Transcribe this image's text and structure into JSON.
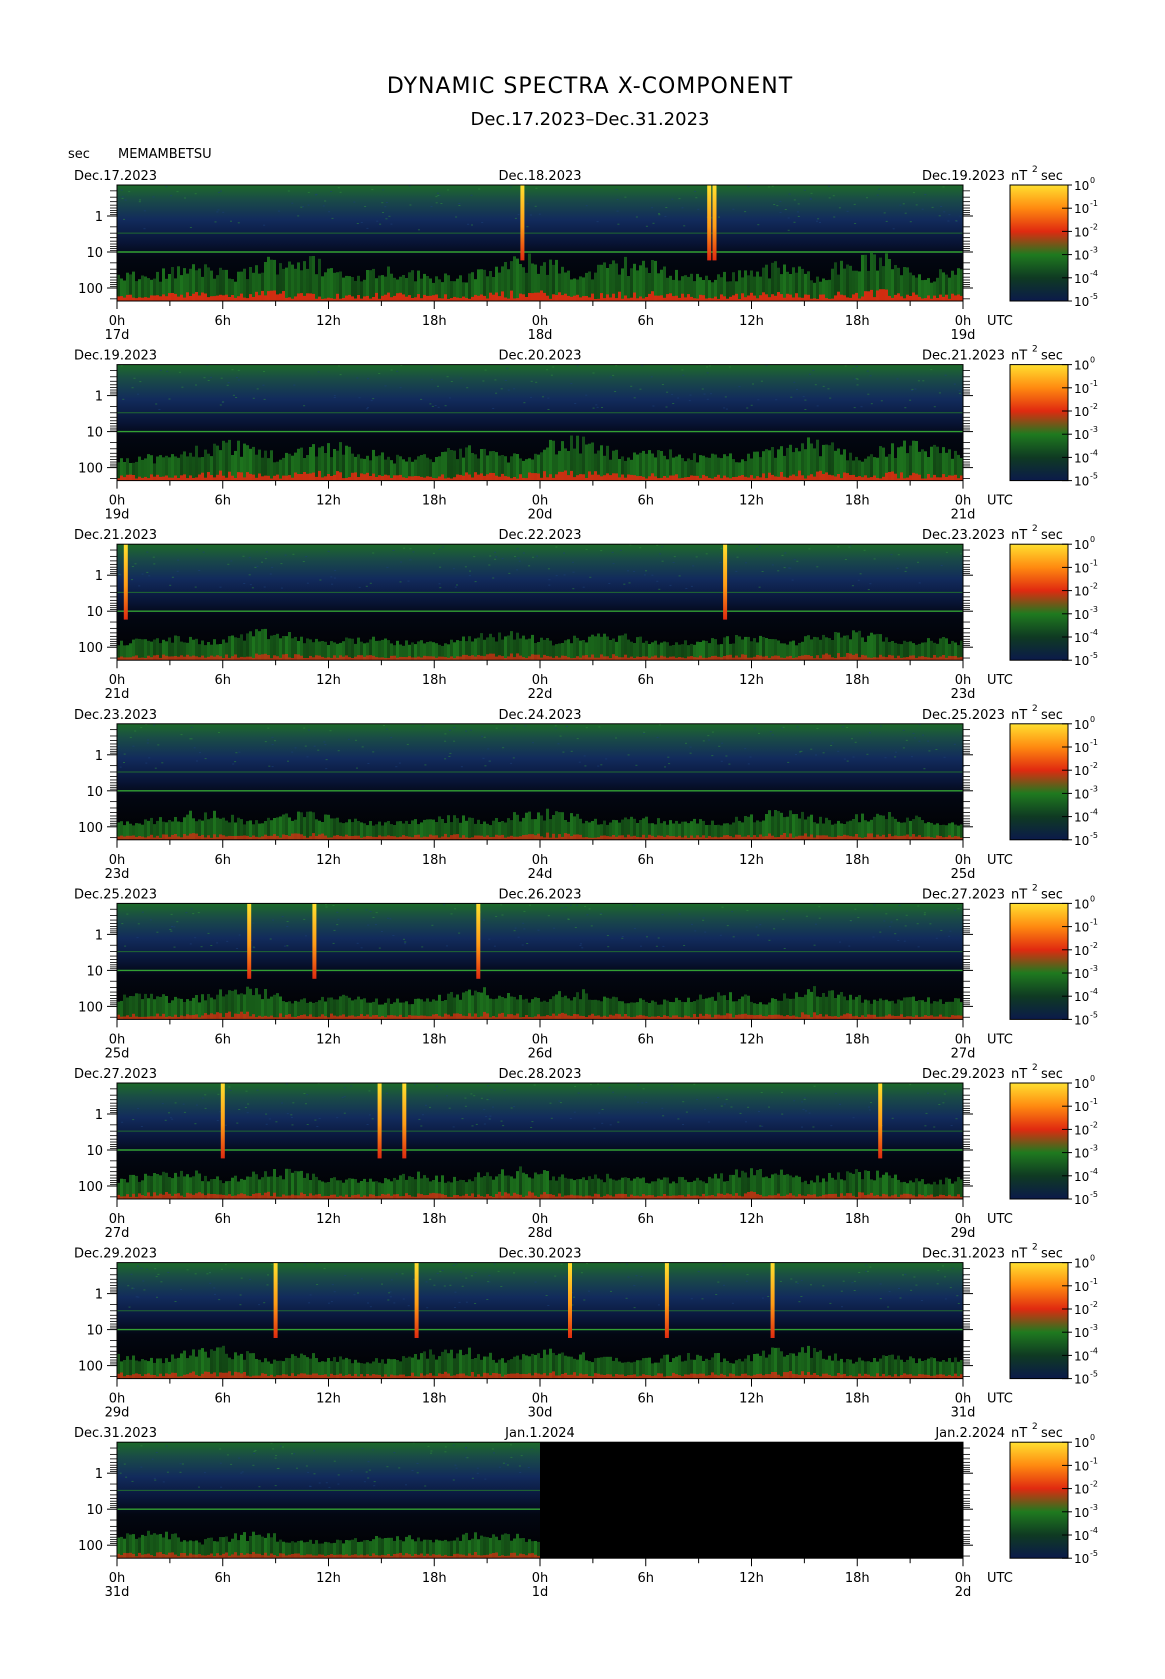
{
  "title": "DYNAMIC SPECTRA X-COMPONENT",
  "subtitle": "Dec.17.2023–Dec.31.2023",
  "yunit": "sec",
  "station": "MEMAMBETSU",
  "unit_label": "nT",
  "unit_exp": "2",
  "unit_tail": "sec",
  "utc_label": "UTC",
  "colors": {
    "background": "#000000",
    "low": "#0b1a4a",
    "mid": "#1f7a1f",
    "high": "#e02a10",
    "peak": "#ffe030"
  },
  "chart_data": {
    "type": "heatmap",
    "y_ticks": [
      "1",
      "10",
      "100"
    ],
    "x_ticks": [
      "0h",
      "6h",
      "12h",
      "18h",
      "0h",
      "6h",
      "12h",
      "18h",
      "0h"
    ],
    "colorbar_ticks": [
      {
        "base": "10",
        "exp": "0"
      },
      {
        "base": "10",
        "exp": "-1"
      },
      {
        "base": "10",
        "exp": "-2"
      },
      {
        "base": "10",
        "exp": "-3"
      },
      {
        "base": "10",
        "exp": "-4"
      },
      {
        "base": "10",
        "exp": "-5"
      }
    ],
    "panels": [
      {
        "left_date": "Dec.17.2023",
        "mid_date": "Dec.18.2023",
        "right_date": "Dec.19.2023",
        "day_labels": [
          "17d",
          "18d",
          "19d"
        ],
        "activity": 0.85,
        "spikes": [
          23.0,
          33.6,
          33.9
        ],
        "blank_from": null
      },
      {
        "left_date": "Dec.19.2023",
        "mid_date": "Dec.20.2023",
        "right_date": "Dec.21.2023",
        "day_labels": [
          "19d",
          "20d",
          "21d"
        ],
        "activity": 0.75,
        "spikes": [],
        "blank_from": null
      },
      {
        "left_date": "Dec.21.2023",
        "mid_date": "Dec.22.2023",
        "right_date": "Dec.23.2023",
        "day_labels": [
          "21d",
          "22d",
          "23d"
        ],
        "activity": 0.45,
        "spikes": [
          0.5,
          34.5
        ],
        "blank_from": null
      },
      {
        "left_date": "Dec.23.2023",
        "mid_date": "Dec.24.2023",
        "right_date": "Dec.25.2023",
        "day_labels": [
          "23d",
          "24d",
          "25d"
        ],
        "activity": 0.45,
        "spikes": [],
        "blank_from": null
      },
      {
        "left_date": "Dec.25.2023",
        "mid_date": "Dec.26.2023",
        "right_date": "Dec.27.2023",
        "day_labels": [
          "25d",
          "26d",
          "27d"
        ],
        "activity": 0.5,
        "spikes": [
          7.5,
          11.2,
          20.5
        ],
        "blank_from": null
      },
      {
        "left_date": "Dec.27.2023",
        "mid_date": "Dec.28.2023",
        "right_date": "Dec.29.2023",
        "day_labels": [
          "27d",
          "28d",
          "29d"
        ],
        "activity": 0.5,
        "spikes": [
          6.0,
          14.9,
          16.3,
          43.3
        ],
        "blank_from": null
      },
      {
        "left_date": "Dec.29.2023",
        "mid_date": "Dec.30.2023",
        "right_date": "Dec.31.2023",
        "day_labels": [
          "29d",
          "30d",
          "31d"
        ],
        "activity": 0.5,
        "spikes": [
          9.0,
          17.0,
          25.7,
          31.2,
          37.2
        ],
        "blank_from": null
      },
      {
        "left_date": "Dec.31.2023",
        "mid_date": "Jan.1.2024",
        "right_date": "Jan.2.2024",
        "day_labels": [
          "31d",
          "1d",
          "2d"
        ],
        "activity": 0.4,
        "spikes": [],
        "blank_from": 24
      }
    ]
  }
}
